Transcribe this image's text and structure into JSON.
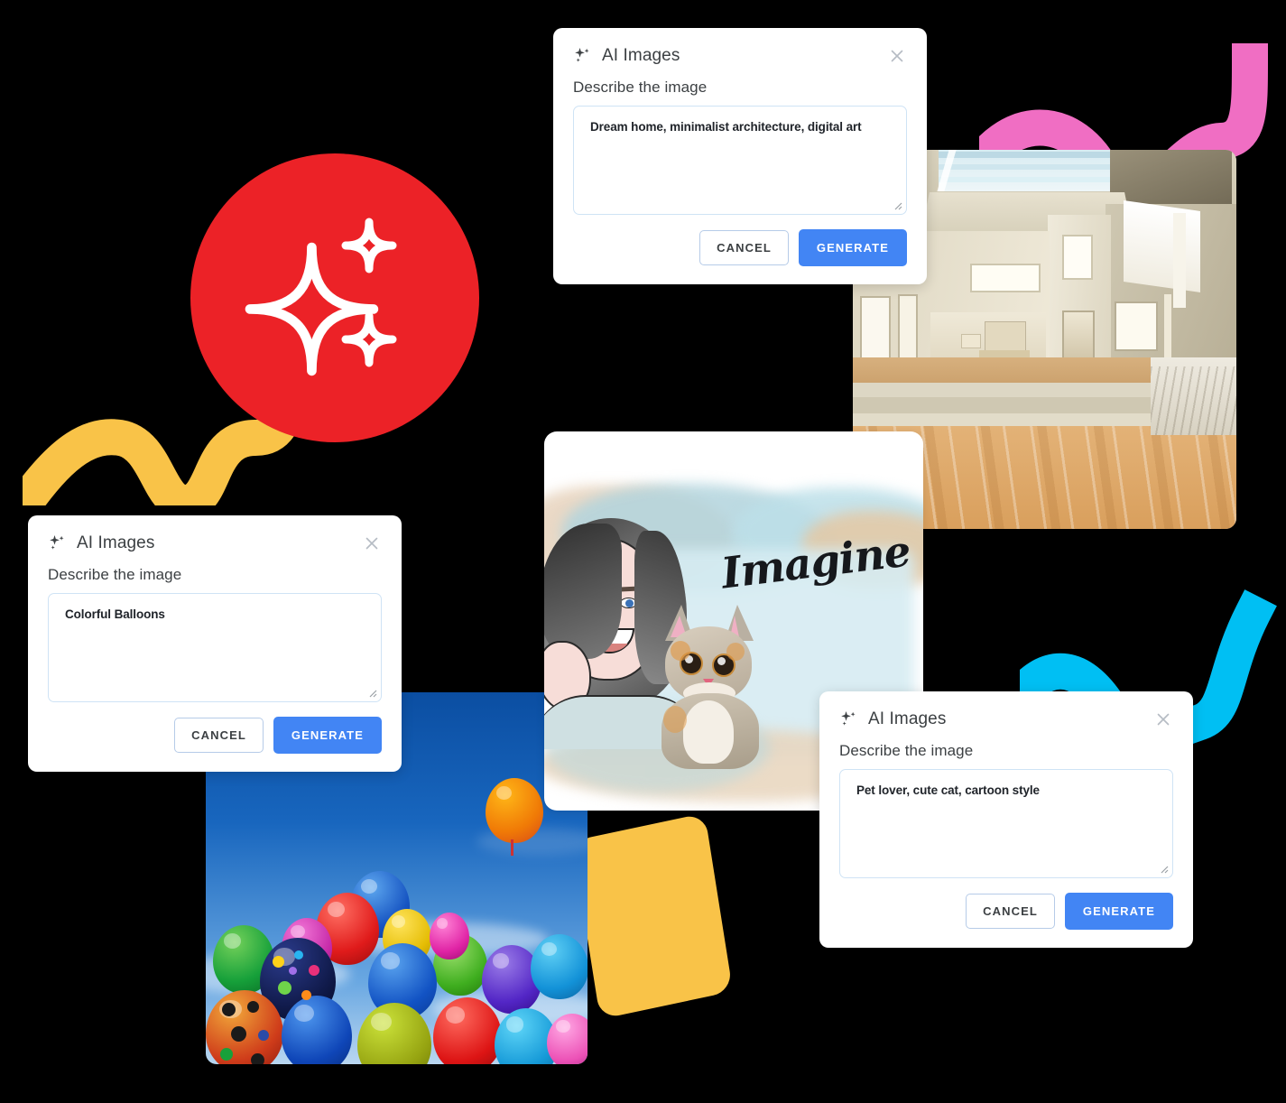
{
  "app": {
    "dialog_title": "AI Images",
    "field_label": "Describe the image",
    "cancel_label": "CANCEL",
    "generate_label": "GENERATE",
    "placeholder": "Describe the image",
    "close_label": "Close"
  },
  "dialogs": [
    {
      "id": "dream-home",
      "title": "AI Images",
      "label": "Describe the image",
      "prompt": "Dream home, minimalist architecture, digital art",
      "cancel": "CANCEL",
      "generate": "GENERATE"
    },
    {
      "id": "colorful-balloons",
      "title": "AI Images",
      "label": "Describe the image",
      "prompt": "Colorful Balloons",
      "cancel": "CANCEL",
      "generate": "GENERATE"
    },
    {
      "id": "pet-lover",
      "title": "AI Images",
      "label": "Describe the image",
      "prompt": "Pet lover, cute cat, cartoon style",
      "cancel": "CANCEL",
      "generate": "GENERATE"
    }
  ],
  "artwork": {
    "imagine_word": "Imagine"
  },
  "icons": {
    "sparkle": "sparkle-icon",
    "close": "close-icon",
    "resize": "resize-grip-icon"
  },
  "colors": {
    "brand_red": "#EC2227",
    "accent_blue": "#4285F4",
    "squiggle_yellow": "#F9C348",
    "squiggle_pink": "#F06EC3",
    "squiggle_cyan": "#00BFF3",
    "textarea_border": "#CFE3F5",
    "cancel_border": "#B6CBE8",
    "text_primary": "#3C4043"
  }
}
